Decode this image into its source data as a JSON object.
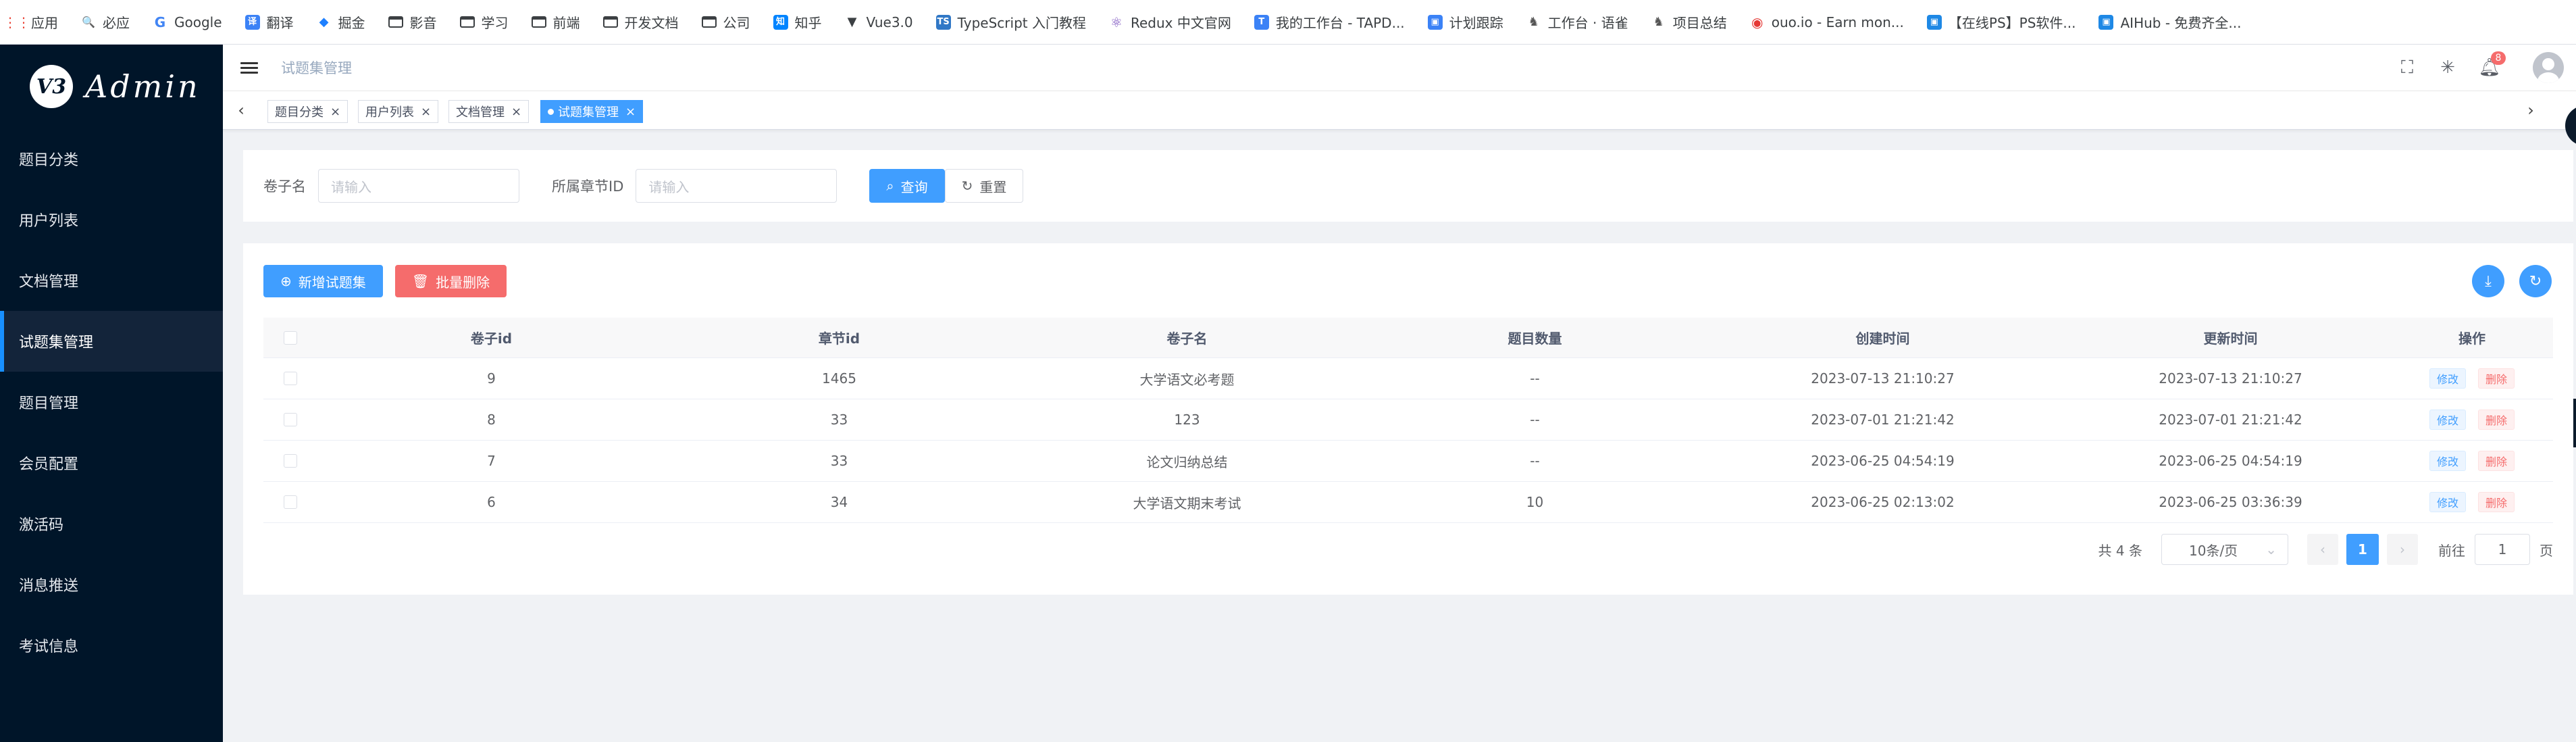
{
  "bookmarks": [
    {
      "label": "应用",
      "icon": "apps-grid-icon",
      "color": "#ea4335"
    },
    {
      "label": "必应",
      "icon": "search-icon",
      "color": "#4285f4"
    },
    {
      "label": "Google",
      "icon": "google-icon",
      "color": "#4285f4"
    },
    {
      "label": "翻译",
      "icon": "translate-icon",
      "color": "#3b82f6"
    },
    {
      "label": "掘金",
      "icon": "juejin-icon",
      "color": "#1e80ff"
    },
    {
      "label": "影音",
      "icon": "folder-icon",
      "color": "#3c4043"
    },
    {
      "label": "学习",
      "icon": "folder-icon",
      "color": "#3c4043"
    },
    {
      "label": "前端",
      "icon": "folder-icon",
      "color": "#3c4043"
    },
    {
      "label": "开发文档",
      "icon": "folder-icon",
      "color": "#3c4043"
    },
    {
      "label": "公司",
      "icon": "folder-icon",
      "color": "#3c4043"
    },
    {
      "label": "知乎",
      "icon": "zhihu-icon",
      "color": "#0084ff"
    },
    {
      "label": "Vue3.0",
      "icon": "vue-icon",
      "color": "#3c4043"
    },
    {
      "label": "TypeScript 入门教程",
      "icon": "ts-icon",
      "color": "#3178c6"
    },
    {
      "label": "Redux 中文官网",
      "icon": "redux-icon",
      "color": "#764abc"
    },
    {
      "label": "我的工作台 - TAPD...",
      "icon": "tapd-icon",
      "color": "#3b82f6"
    },
    {
      "label": "计划跟踪",
      "icon": "plan-icon",
      "color": "#3b82f6"
    },
    {
      "label": "工作台 · 语雀",
      "icon": "yuque-icon",
      "color": "#555555"
    },
    {
      "label": "项目总结",
      "icon": "yuque-icon",
      "color": "#555555"
    },
    {
      "label": "ouo.io - Earn mon...",
      "icon": "ouo-icon",
      "color": "#e53935"
    },
    {
      "label": "【在线PS】PS软件...",
      "icon": "ps-icon",
      "color": "#1e88e5"
    },
    {
      "label": "AIHub - 免费齐全...",
      "icon": "aihub-icon",
      "color": "#1e88e5"
    }
  ],
  "sidebar": {
    "logo_mark": "V3",
    "logo_text": "Admin",
    "items": [
      {
        "label": "题目分类"
      },
      {
        "label": "用户列表"
      },
      {
        "label": "文档管理"
      },
      {
        "label": "试题集管理"
      },
      {
        "label": "题目管理"
      },
      {
        "label": "会员配置"
      },
      {
        "label": "激活码"
      },
      {
        "label": "消息推送"
      },
      {
        "label": "考试信息"
      }
    ],
    "active_index": 3
  },
  "header": {
    "breadcrumb": "试题集管理",
    "notification_count": "8"
  },
  "tags": [
    {
      "label": "题目分类"
    },
    {
      "label": "用户列表"
    },
    {
      "label": "文档管理"
    },
    {
      "label": "试题集管理"
    }
  ],
  "search": {
    "field1_label": "卷子名",
    "field1_placeholder": "请输入",
    "field2_label": "所属章节ID",
    "field2_placeholder": "请输入",
    "query_label": "查询",
    "reset_label": "重置"
  },
  "toolbar": {
    "add_label": "新增试题集",
    "batch_delete_label": "批量删除"
  },
  "table": {
    "columns": [
      "卷子id",
      "章节id",
      "卷子名",
      "题目数量",
      "创建时间",
      "更新时间",
      "操作"
    ],
    "rows": [
      {
        "id": "9",
        "chapter": "1465",
        "name": "大学语文必考题",
        "count": "--",
        "created": "2023-07-13 21:10:27",
        "updated": "2023-07-13 21:10:27"
      },
      {
        "id": "8",
        "chapter": "33",
        "name": "123",
        "count": "--",
        "created": "2023-07-01 21:21:42",
        "updated": "2023-07-01 21:21:42"
      },
      {
        "id": "7",
        "chapter": "33",
        "name": "论文归纳总结",
        "count": "--",
        "created": "2023-06-25 04:54:19",
        "updated": "2023-06-25 04:54:19"
      },
      {
        "id": "6",
        "chapter": "34",
        "name": "大学语文期末考试",
        "count": "10",
        "created": "2023-06-25 02:13:02",
        "updated": "2023-06-25 03:36:39"
      }
    ],
    "edit_label": "修改",
    "delete_label": "删除"
  },
  "pagination": {
    "total": "共 4 条",
    "page_size": "10条/页",
    "current_page": "1",
    "goto_prefix": "前往",
    "goto_value": "1",
    "goto_suffix": "页"
  },
  "colors": {
    "primary": "#409eff",
    "danger": "#f56c6c",
    "sidebar_bg": "#001529"
  }
}
